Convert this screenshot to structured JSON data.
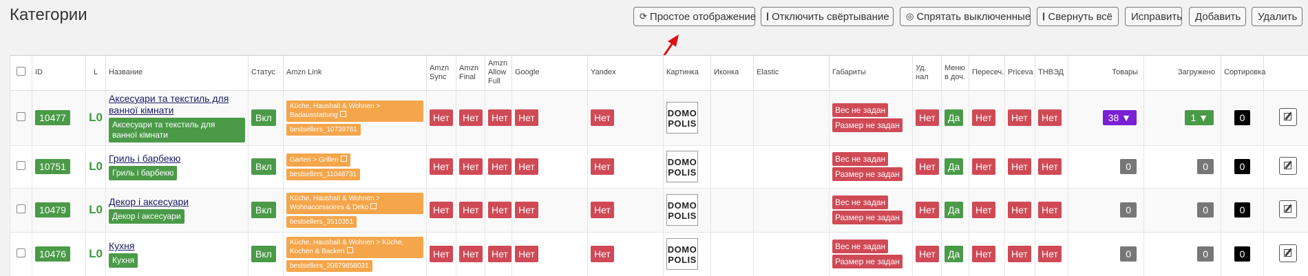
{
  "page_title": "Категории",
  "toolbar": {
    "simple_view": "Простое отображение",
    "disable_collapse": "Отключить свёртывание",
    "hide_disabled": "Спрятать выключенные",
    "collapse_all": "Свернуть всё",
    "fix": "Исправить",
    "add": "Добавить",
    "delete": "Удалить"
  },
  "columns": {
    "id": "ID",
    "l": "L",
    "name": "Название",
    "status": "Статус",
    "amzn_link": "Amzn Link",
    "amzn_sync": "Amzn Sync",
    "amzn_final": "Amzn Final",
    "amzn_allow_full": "Amzn Allow Full",
    "google": "Google",
    "yandex": "Yandex",
    "picture": "Картинка",
    "icon": "Иконка",
    "elastic": "Elastic",
    "dimensions": "Габариты",
    "ud_nal": "Уд. нал",
    "menu_doch": "Меню в доч.",
    "peresech": "Пересеч.",
    "priceva": "Priceva",
    "tnved": "ТНВЭД",
    "products": "Товары",
    "loaded": "Загружено",
    "sorting": "Сортировка"
  },
  "logo_text": {
    "line1": "DOMO",
    "line2": "POLIS"
  },
  "rows": [
    {
      "id": "10477",
      "level": "L0",
      "name": "Аксесуари та текстиль для ванної кімнати",
      "tag": "Аксесуари та текстиль для ванної кімнати",
      "status": "Вкл",
      "amzn": "Küche, Haushalt & Wohnen > Badausstattung",
      "bs": "bestsellers_10739781",
      "sync": "Нет",
      "final": "Нет",
      "allow": "Нет",
      "google": "Нет",
      "yandex": "Нет",
      "weight": "Вес не задан",
      "size": "Размер не задан",
      "ud": "Нет",
      "menu": "Да",
      "pere": "Нет",
      "priceva": "Нет",
      "tnved": "Нет",
      "products": "38",
      "loaded": "1",
      "sort": "0"
    },
    {
      "id": "10751",
      "level": "L0",
      "name": "Гриль і барбекю",
      "tag": "Гриль і барбекю",
      "status": "Вкл",
      "amzn": "Garten > Grillen",
      "bs": "bestsellers_11048731",
      "sync": "Нет",
      "final": "Нет",
      "allow": "Нет",
      "google": "Нет",
      "yandex": "Нет",
      "weight": "Вес не задан",
      "size": "Размер не задан",
      "ud": "Нет",
      "menu": "Да",
      "pere": "Нет",
      "priceva": "Нет",
      "tnved": "Нет",
      "products": "0",
      "loaded": "0",
      "sort": "0"
    },
    {
      "id": "10479",
      "level": "L0",
      "name": "Декор і аксесуари",
      "tag": "Декор і аксесуари",
      "status": "Вкл",
      "amzn": "Küche, Haushalt & Wohnen > Wohnaccessoires & Deko",
      "bs": "bestsellers_3510351",
      "sync": "Нет",
      "final": "Нет",
      "allow": "Нет",
      "google": "Нет",
      "yandex": "Нет",
      "weight": "Вес не задан",
      "size": "Размер не задан",
      "ud": "Нет",
      "menu": "Да",
      "pere": "Нет",
      "priceva": "Нет",
      "tnved": "Нет",
      "products": "0",
      "loaded": "0",
      "sort": "0"
    },
    {
      "id": "10476",
      "level": "L0",
      "name": "Кухня",
      "tag": "Кухня",
      "status": "Вкл",
      "amzn": "Küche, Haushalt & Wohnen > Küche, Kochen & Backen",
      "bs": "bestsellers_20679858031",
      "sync": "Нет",
      "final": "Нет",
      "allow": "Нет",
      "google": "Нет",
      "yandex": "Нет",
      "weight": "Вес не задан",
      "size": "Размер не задан",
      "ud": "Нет",
      "menu": "Да",
      "pere": "Нет",
      "priceva": "Нет",
      "tnved": "Нет",
      "products": "0",
      "loaded": "0",
      "sort": "0"
    }
  ]
}
